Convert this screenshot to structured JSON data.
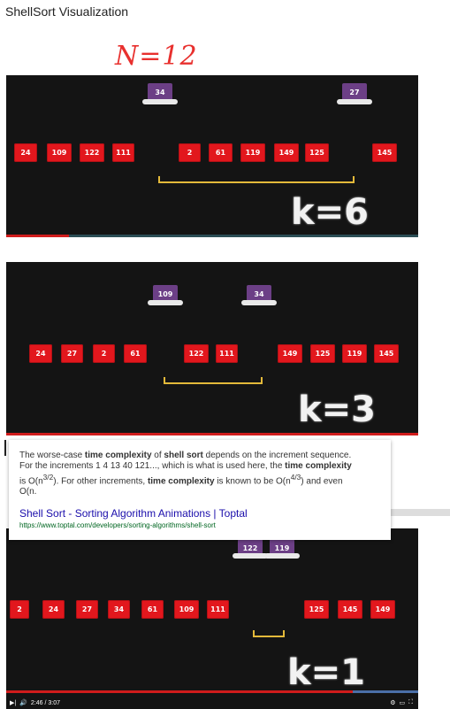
{
  "page_title": "ShellSort Visualization",
  "annotation": "N=12",
  "frames": [
    {
      "k_label": "k=6",
      "hats": [
        "34",
        "27"
      ],
      "tiles": [
        "24",
        "109",
        "122",
        "111",
        "2",
        "61",
        "119",
        "149",
        "125",
        "145"
      ]
    },
    {
      "k_label": "k=3",
      "hats": [
        "109",
        "34"
      ],
      "tiles": [
        "24",
        "27",
        "2",
        "61",
        "122",
        "111",
        "149",
        "125",
        "119",
        "145"
      ]
    },
    {
      "k_label": "k=1",
      "hats": [
        "122",
        "119"
      ],
      "tiles": [
        "2",
        "24",
        "27",
        "34",
        "61",
        "109",
        "111",
        "125",
        "145",
        "149"
      ],
      "time": "2:46 / 3:07"
    }
  ],
  "snippet": {
    "line1_pre": "The worse-case ",
    "line1_b1": "time complexity",
    "line1_mid": " of ",
    "line1_b2": "shell sort",
    "line1_post": " depends on the increment sequence.",
    "line2_pre": "For the increments 1 4 13 40 121..., which is what is used here, the ",
    "line2_b": "time complexity",
    "line3_pre": "is O(n",
    "line3_exp": "3/2",
    "line3_mid": "). For other increments, ",
    "line3_b": "time complexity",
    "line3_post": " is known to be O(n",
    "line3_exp2": "4/3",
    "line3_end": ") and even",
    "line4": "O(n.",
    "link_text": "Shell Sort - Sorting Algorithm Animations | Toptal",
    "url": "https://www.toptal.com/developers/sorting-algorithms/shell-sort"
  },
  "colors": {
    "tile": "#e2171d",
    "hat": "#6c3f86",
    "bracket": "#e3b93a",
    "link": "#1a0dab",
    "url": "#006621"
  }
}
